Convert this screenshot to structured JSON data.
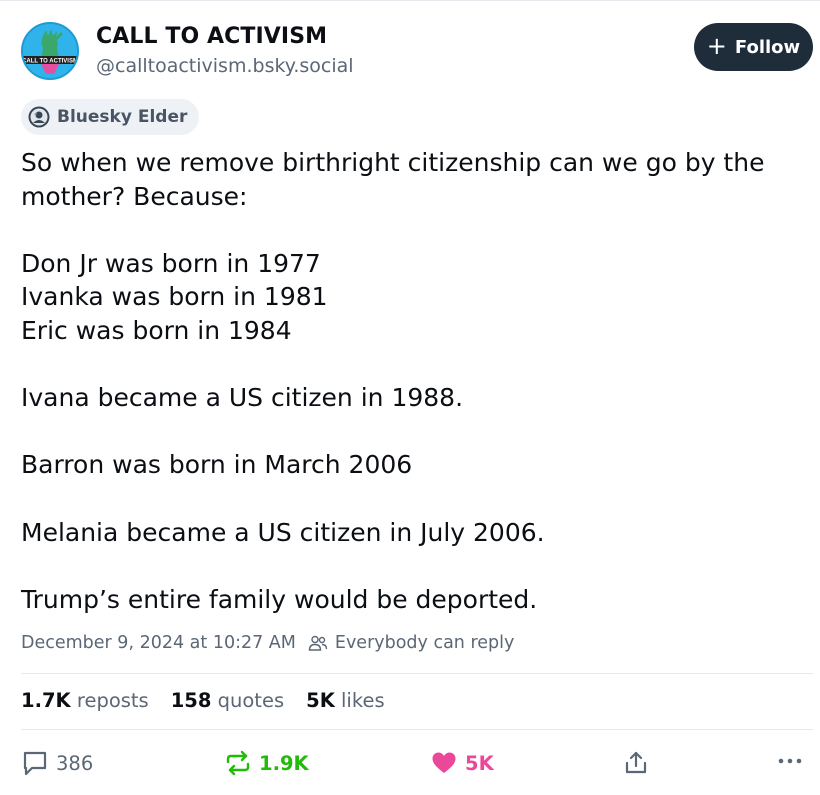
{
  "author": {
    "name": "CALL TO ACTIVISM",
    "handle": "@calltoactivism.bsky.social",
    "avatar_text": "CALL TO ACTIVISM"
  },
  "follow_button": {
    "icon": "plus-icon",
    "label": "Follow"
  },
  "badge": {
    "label": "Bluesky Elder",
    "icon": "elder-avatar-icon"
  },
  "post": {
    "lines": [
      "So when we remove birthright citizenship can we go by the",
      "mother? Because:",
      "",
      "Don Jr was born in 1977",
      "Ivanka was born in 1981",
      "Eric was born in 1984",
      "",
      "Ivana became a US citizen in 1988.",
      "",
      "Barron was born in March 2006",
      "",
      "Melania became a US citizen in July 2006.",
      "",
      "Trump’s entire family would be deported."
    ]
  },
  "meta": {
    "timestamp": "December 9, 2024 at 10:27 AM",
    "reply_setting": "Everybody can reply"
  },
  "stats": {
    "reposts_count": "1.7K",
    "reposts_label": "reposts",
    "quotes_count": "158",
    "quotes_label": "quotes",
    "likes_count": "5K",
    "likes_label": "likes"
  },
  "actions": {
    "reply_count": "386",
    "repost_count": "1.9K",
    "like_count": "5K"
  },
  "colors": {
    "follow_bg": "#1f2d3a",
    "repost_green": "#20bc07",
    "like_pink": "#ec4899",
    "muted_text": "#5b6776"
  }
}
